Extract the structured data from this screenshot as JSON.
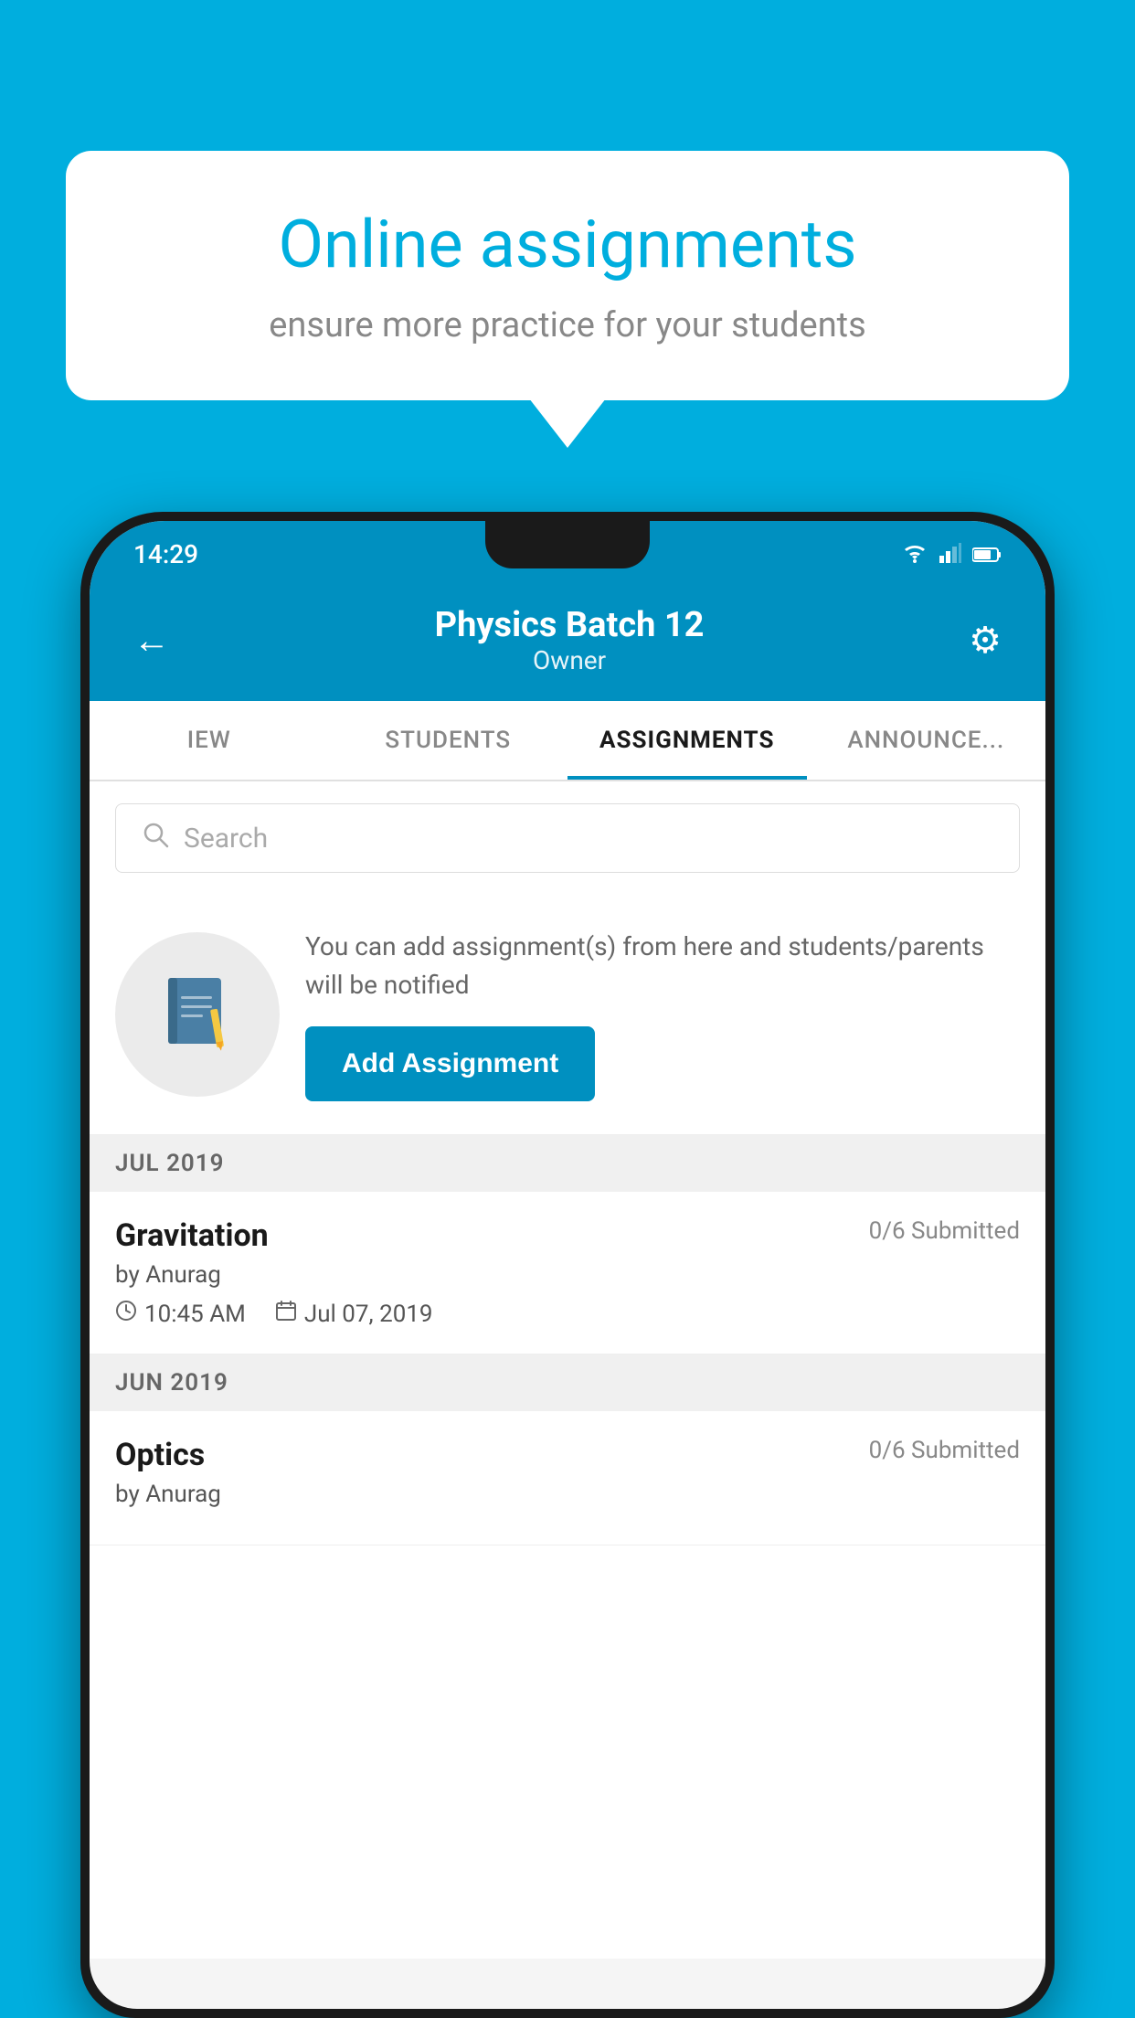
{
  "background_color": "#00AEDE",
  "speech_bubble": {
    "title": "Online assignments",
    "subtitle": "ensure more practice for your students"
  },
  "status_bar": {
    "time": "14:29",
    "wifi": "▾",
    "signal": "▲",
    "battery": "▮"
  },
  "header": {
    "title": "Physics Batch 12",
    "subtitle": "Owner",
    "back_label": "←",
    "settings_label": "⚙"
  },
  "tabs": [
    {
      "label": "IEW",
      "active": false
    },
    {
      "label": "STUDENTS",
      "active": false
    },
    {
      "label": "ASSIGNMENTS",
      "active": true
    },
    {
      "label": "ANNOUNCE...",
      "active": false
    }
  ],
  "search": {
    "placeholder": "Search"
  },
  "add_assignment_section": {
    "description": "You can add assignment(s) from here and students/parents will be notified",
    "button_label": "Add Assignment"
  },
  "sections": [
    {
      "label": "JUL 2019",
      "assignments": [
        {
          "name": "Gravitation",
          "submitted": "0/6 Submitted",
          "by": "by Anurag",
          "time": "10:45 AM",
          "date": "Jul 07, 2019"
        }
      ]
    },
    {
      "label": "JUN 2019",
      "assignments": [
        {
          "name": "Optics",
          "submitted": "0/6 Submitted",
          "by": "by Anurag",
          "time": "",
          "date": ""
        }
      ]
    }
  ]
}
